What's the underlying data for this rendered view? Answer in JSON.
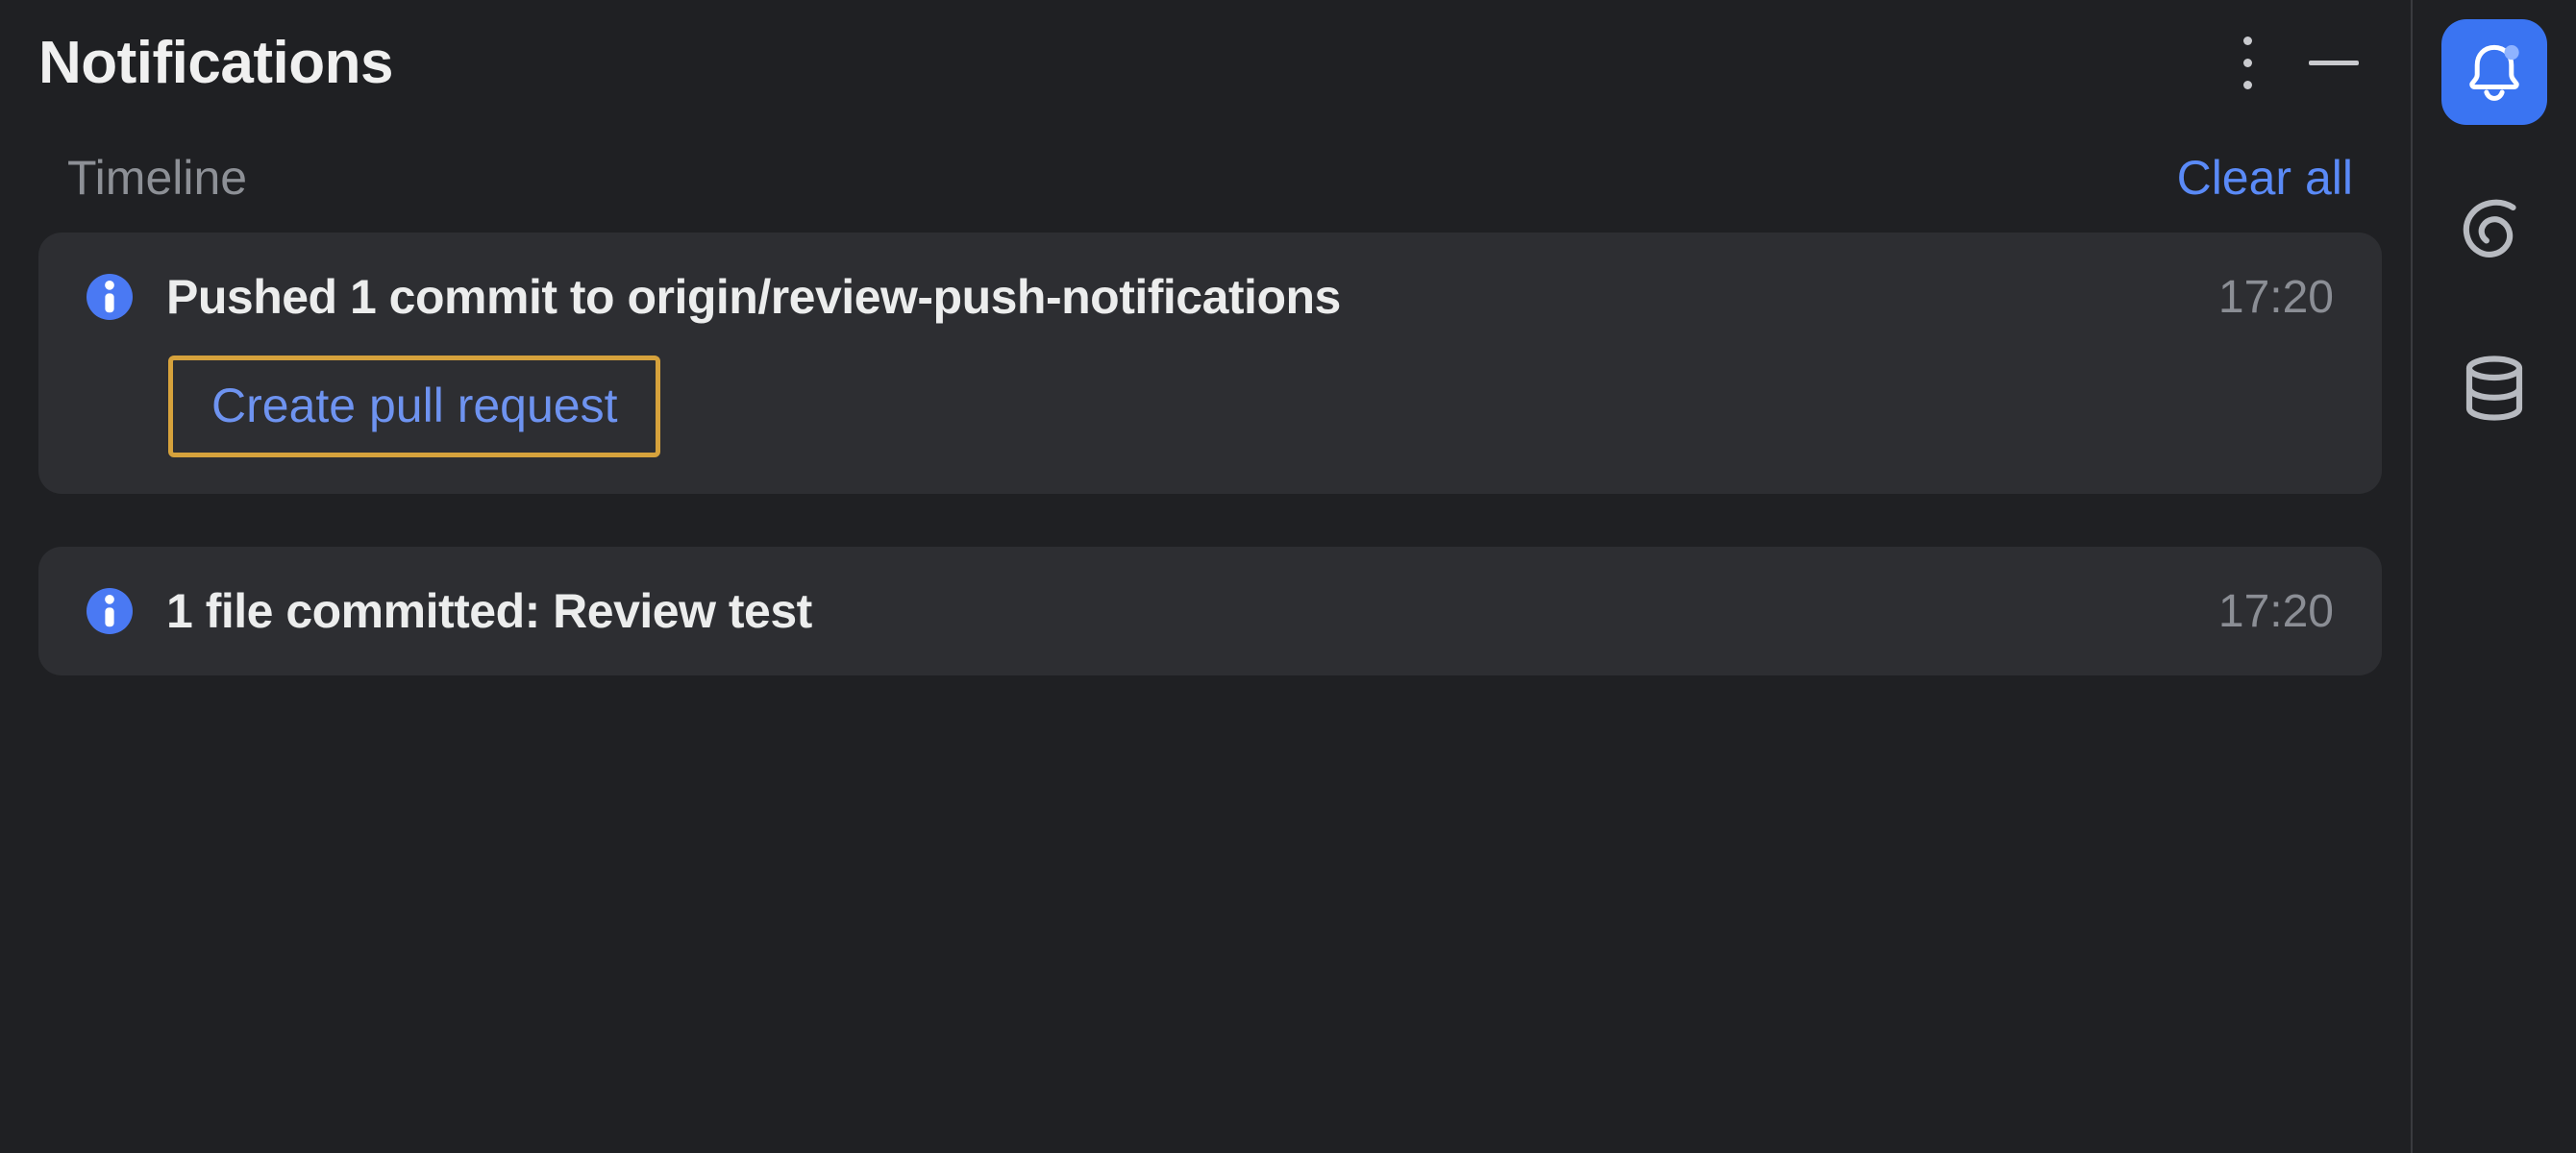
{
  "panel": {
    "title": "Notifications",
    "timeline_label": "Timeline",
    "clear_all_label": "Clear all"
  },
  "notifications": [
    {
      "title": "Pushed 1 commit to origin/review-push-notifications",
      "time": "17:20",
      "action_label": "Create pull request"
    },
    {
      "title": "1 file committed: Review test",
      "time": "17:20"
    }
  ],
  "icons": {
    "kebab": "more-options-icon",
    "minimize": "minimize-icon",
    "info": "info-icon",
    "bell": "bell-icon",
    "spiral": "spiral-icon",
    "database": "database-icon"
  },
  "colors": {
    "accent": "#3a74f2",
    "link": "#6e93f0",
    "highlight_border": "#d6a23c",
    "card_bg": "#2d2e32",
    "panel_bg": "#1f2023",
    "muted": "#8d9096"
  }
}
